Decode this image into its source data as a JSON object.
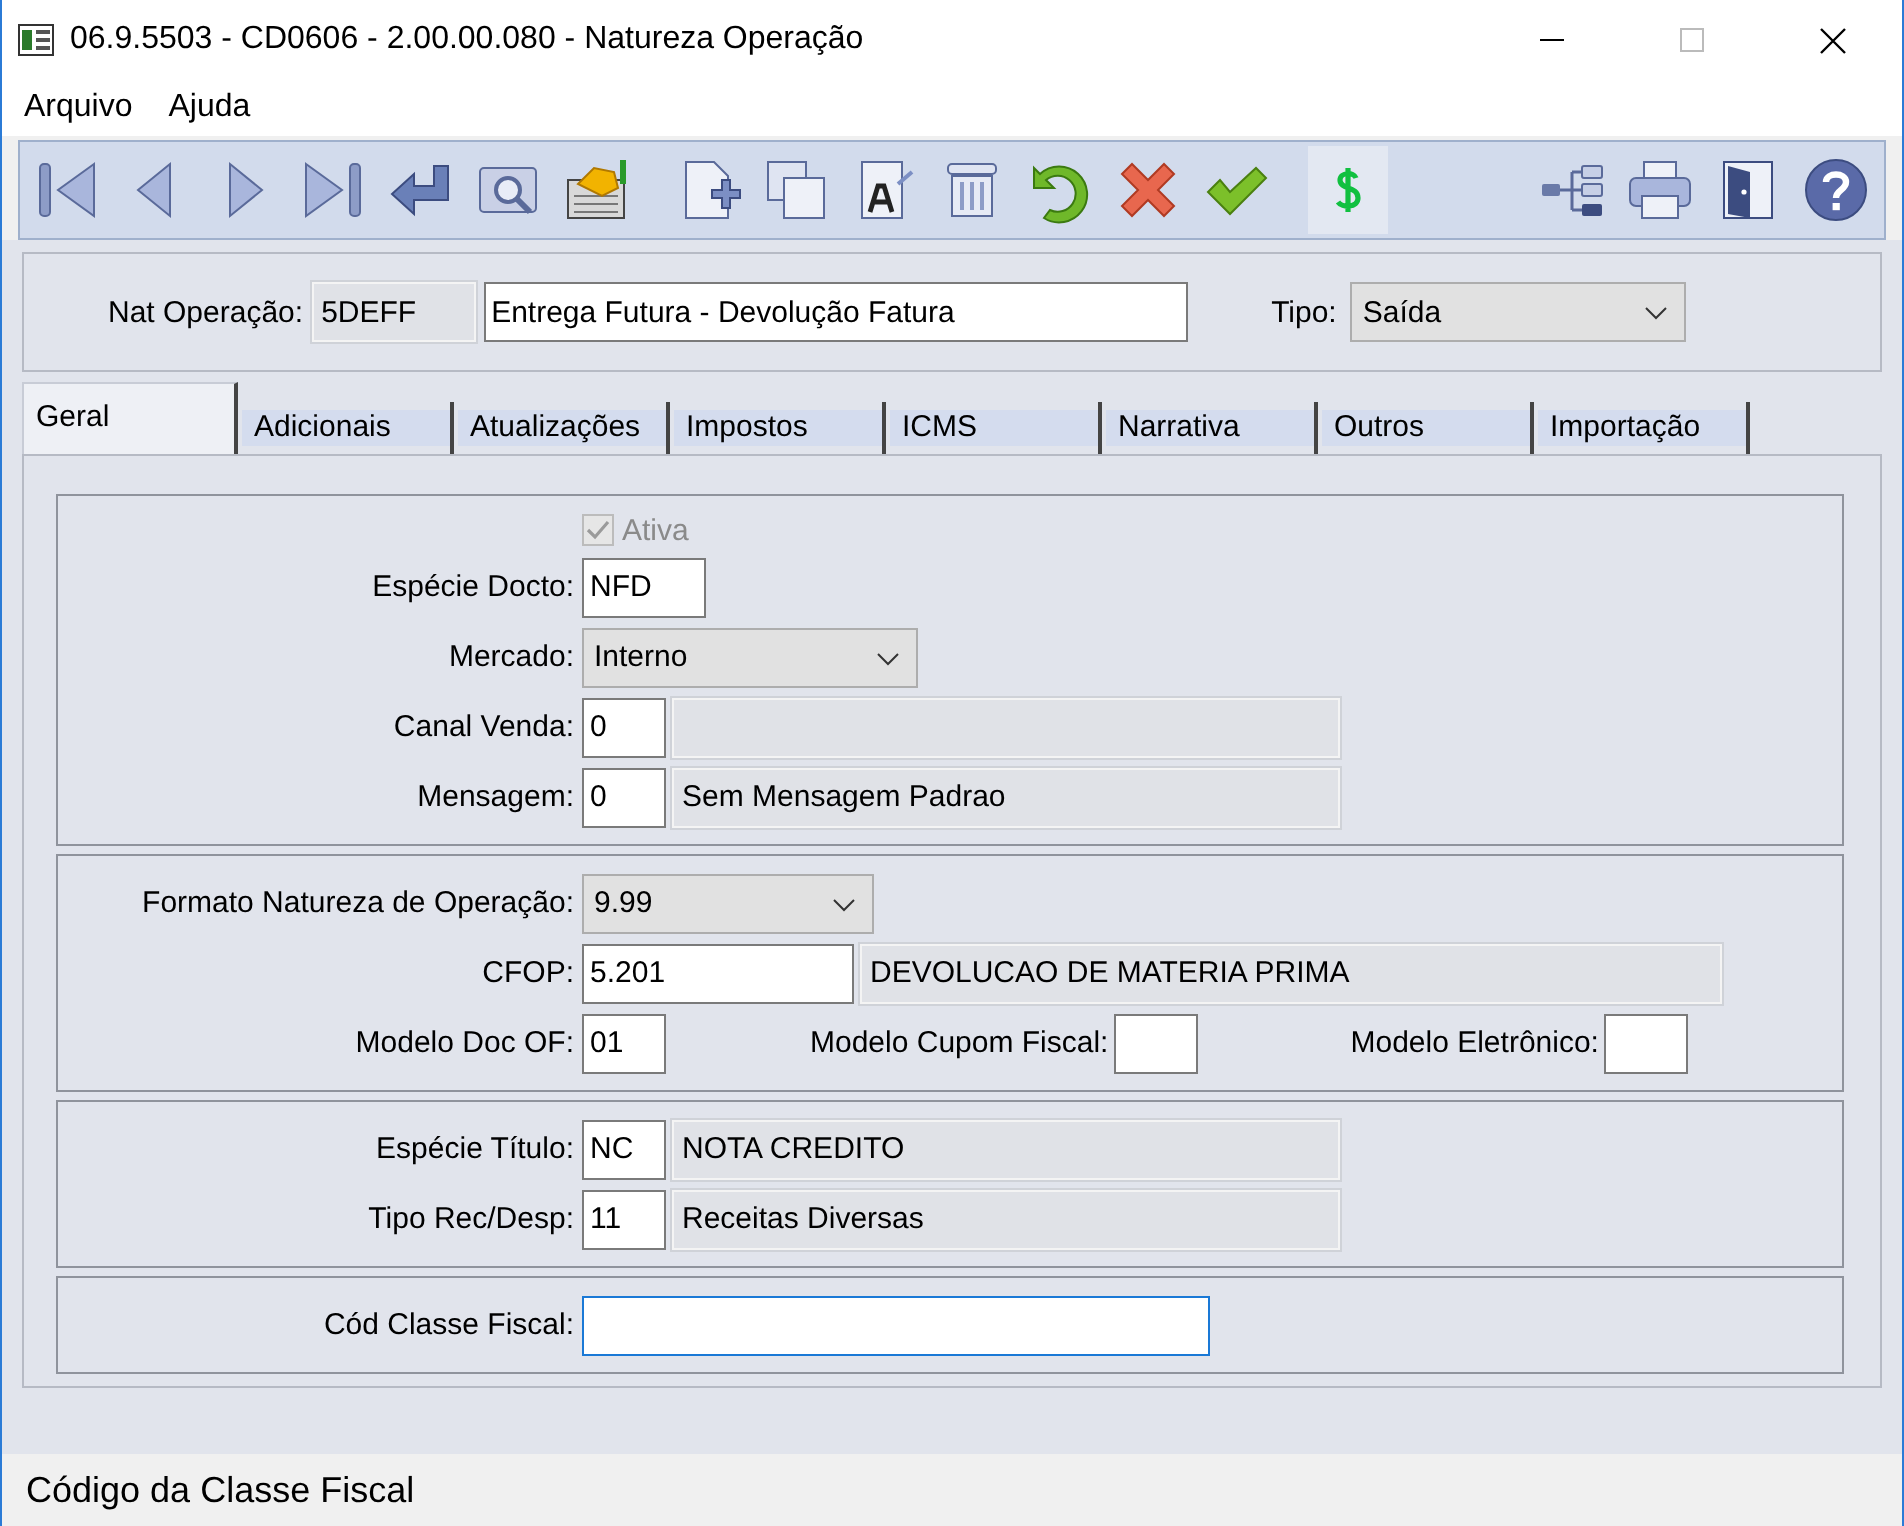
{
  "window": {
    "title": "06.9.5503 - CD0606 - 2.00.00.080 - Natureza Operação"
  },
  "menu": [
    {
      "label": "Arquivo"
    },
    {
      "label": "Ajuda"
    }
  ],
  "toolbar": {
    "left": [
      {
        "kind": "first",
        "pressed": false
      },
      {
        "kind": "prev",
        "pressed": false
      },
      {
        "kind": "next",
        "pressed": false
      },
      {
        "kind": "last",
        "pressed": false
      },
      {
        "kind": "goto",
        "pressed": false
      },
      {
        "kind": "search",
        "pressed": false
      },
      {
        "kind": "zoom",
        "pressed": false
      },
      {
        "kind": "new",
        "pressed": false
      },
      {
        "kind": "copy",
        "pressed": false
      },
      {
        "kind": "edit",
        "pressed": false
      },
      {
        "kind": "delete",
        "pressed": false
      },
      {
        "kind": "undo",
        "pressed": false
      },
      {
        "kind": "cancel",
        "pressed": false
      },
      {
        "kind": "save",
        "pressed": false
      },
      {
        "kind": "currency",
        "pressed": true
      }
    ],
    "right": [
      {
        "kind": "tree",
        "pressed": false
      },
      {
        "kind": "print",
        "pressed": false
      },
      {
        "kind": "exit",
        "pressed": false
      },
      {
        "kind": "help",
        "pressed": false
      }
    ]
  },
  "header": {
    "nat_operacao": {
      "label": "Nat Operação:",
      "code": "5DEFF",
      "description": "Entrega Futura - Devolução Fatura"
    },
    "tipo": {
      "label": "Tipo:",
      "value": "Saída"
    }
  },
  "tabs": [
    {
      "label": "Geral",
      "selected": true
    },
    {
      "label": "Adicionais",
      "selected": false
    },
    {
      "label": "Atualizações",
      "selected": false
    },
    {
      "label": "Impostos",
      "selected": false
    },
    {
      "label": "ICMS",
      "selected": false
    },
    {
      "label": "Narrativa",
      "selected": false
    },
    {
      "label": "Outros",
      "selected": false
    },
    {
      "label": "Importação",
      "selected": false
    }
  ],
  "sections": [
    {
      "rows": [
        {
          "items": [
            {
              "kind": "checkbox",
              "label": "Ativa",
              "checked": true,
              "disabled": true
            }
          ]
        },
        {
          "label": "Espécie Docto:",
          "items": [
            {
              "kind": "input",
              "value": "NFD",
              "focused": false
            }
          ]
        },
        {
          "label": "Mercado:",
          "items": [
            {
              "kind": "select",
              "value": "Interno"
            }
          ]
        },
        {
          "label": "Canal Venda:",
          "items": [
            {
              "kind": "input",
              "value": "0",
              "focused": false
            },
            {
              "kind": "readonly"
            }
          ]
        },
        {
          "label": "Mensagem:",
          "items": [
            {
              "kind": "input",
              "value": "0",
              "focused": false
            },
            {
              "kind": "readonly",
              "value": "Sem Mensagem Padrao"
            }
          ]
        }
      ]
    },
    {
      "rows": [
        {
          "label": "Formato Natureza de Operação:",
          "items": [
            {
              "kind": "select",
              "value": "9.99"
            }
          ]
        },
        {
          "label": "CFOP:",
          "items": [
            {
              "kind": "input",
              "value": "5.201",
              "focused": false
            },
            {
              "kind": "readonly",
              "value": "DEVOLUCAO DE MATERIA PRIMA"
            }
          ]
        },
        {
          "label": "Modelo Doc OF:",
          "items": [
            {
              "kind": "input",
              "value": "01",
              "focused": false
            },
            {
              "kind": "label",
              "value": "Modelo Cupom Fiscal:"
            },
            {
              "kind": "input",
              "focused": false
            },
            {
              "kind": "label",
              "value": "Modelo Eletrônico:"
            },
            {
              "kind": "input",
              "focused": false
            }
          ]
        }
      ]
    },
    {
      "rows": [
        {
          "label": "Espécie Título:",
          "items": [
            {
              "kind": "input",
              "value": "NC",
              "focused": false
            },
            {
              "kind": "readonly",
              "value": "NOTA CREDITO"
            }
          ]
        },
        {
          "label": "Tipo Rec/Desp:",
          "items": [
            {
              "kind": "input",
              "value": "11",
              "focused": false
            },
            {
              "kind": "readonly",
              "value": "Receitas Diversas"
            }
          ]
        }
      ]
    },
    {
      "rows": [
        {
          "label": "Cód Classe Fiscal:",
          "items": [
            {
              "kind": "input",
              "focused": true
            }
          ]
        }
      ]
    }
  ],
  "status_bar": {
    "text": "Código da Classe Fiscal"
  }
}
